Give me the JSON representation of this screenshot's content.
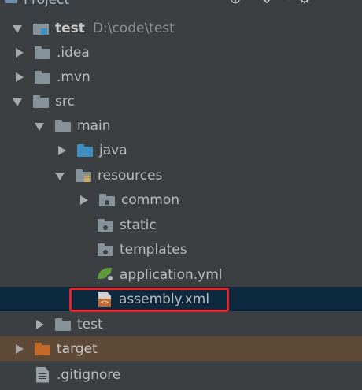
{
  "header": {
    "title": "Project",
    "buttons": [
      "add-icon",
      "collapse-icon",
      "gear-icon"
    ]
  },
  "tree": [
    {
      "label": "test",
      "path": "D:\\code\\test",
      "arrow": "down",
      "icon": "module-icon",
      "depth": 0,
      "bold": true
    },
    {
      "label": ".idea",
      "arrow": "right",
      "icon": "folder-icon",
      "depth": 1
    },
    {
      "label": ".mvn",
      "arrow": "right",
      "icon": "folder-icon",
      "depth": 1
    },
    {
      "label": "src",
      "arrow": "down",
      "icon": "folder-icon",
      "depth": 1
    },
    {
      "label": "main",
      "arrow": "down",
      "icon": "folder-icon",
      "depth": 2
    },
    {
      "label": "java",
      "arrow": "right",
      "icon": "source-folder-icon",
      "depth": 3
    },
    {
      "label": "resources",
      "arrow": "down",
      "icon": "resources-folder-icon",
      "depth": 3
    },
    {
      "label": "common",
      "arrow": "right",
      "icon": "package-folder-icon",
      "depth": 4
    },
    {
      "label": "static",
      "arrow": "none",
      "icon": "package-folder-icon",
      "depth": 4
    },
    {
      "label": "templates",
      "arrow": "none",
      "icon": "package-folder-icon",
      "depth": 4
    },
    {
      "label": "application.yml",
      "arrow": "none",
      "icon": "spring-config-icon",
      "depth": 4
    },
    {
      "label": "assembly.xml",
      "arrow": "none",
      "icon": "xml-file-icon",
      "depth": 4,
      "selected": true
    },
    {
      "label": "test",
      "arrow": "right",
      "icon": "folder-icon",
      "depth": 2
    },
    {
      "label": "target",
      "arrow": "right",
      "icon": "excluded-folder-icon",
      "depth": 1,
      "excluded": true
    },
    {
      "label": ".gitignore",
      "arrow": "none",
      "icon": "text-file-icon",
      "depth": 1
    }
  ],
  "colors": {
    "background": "#3c3f41",
    "selected_row": "#0d293e",
    "excluded_row": "#5e4a36",
    "highlight_box": "#e8242b"
  }
}
